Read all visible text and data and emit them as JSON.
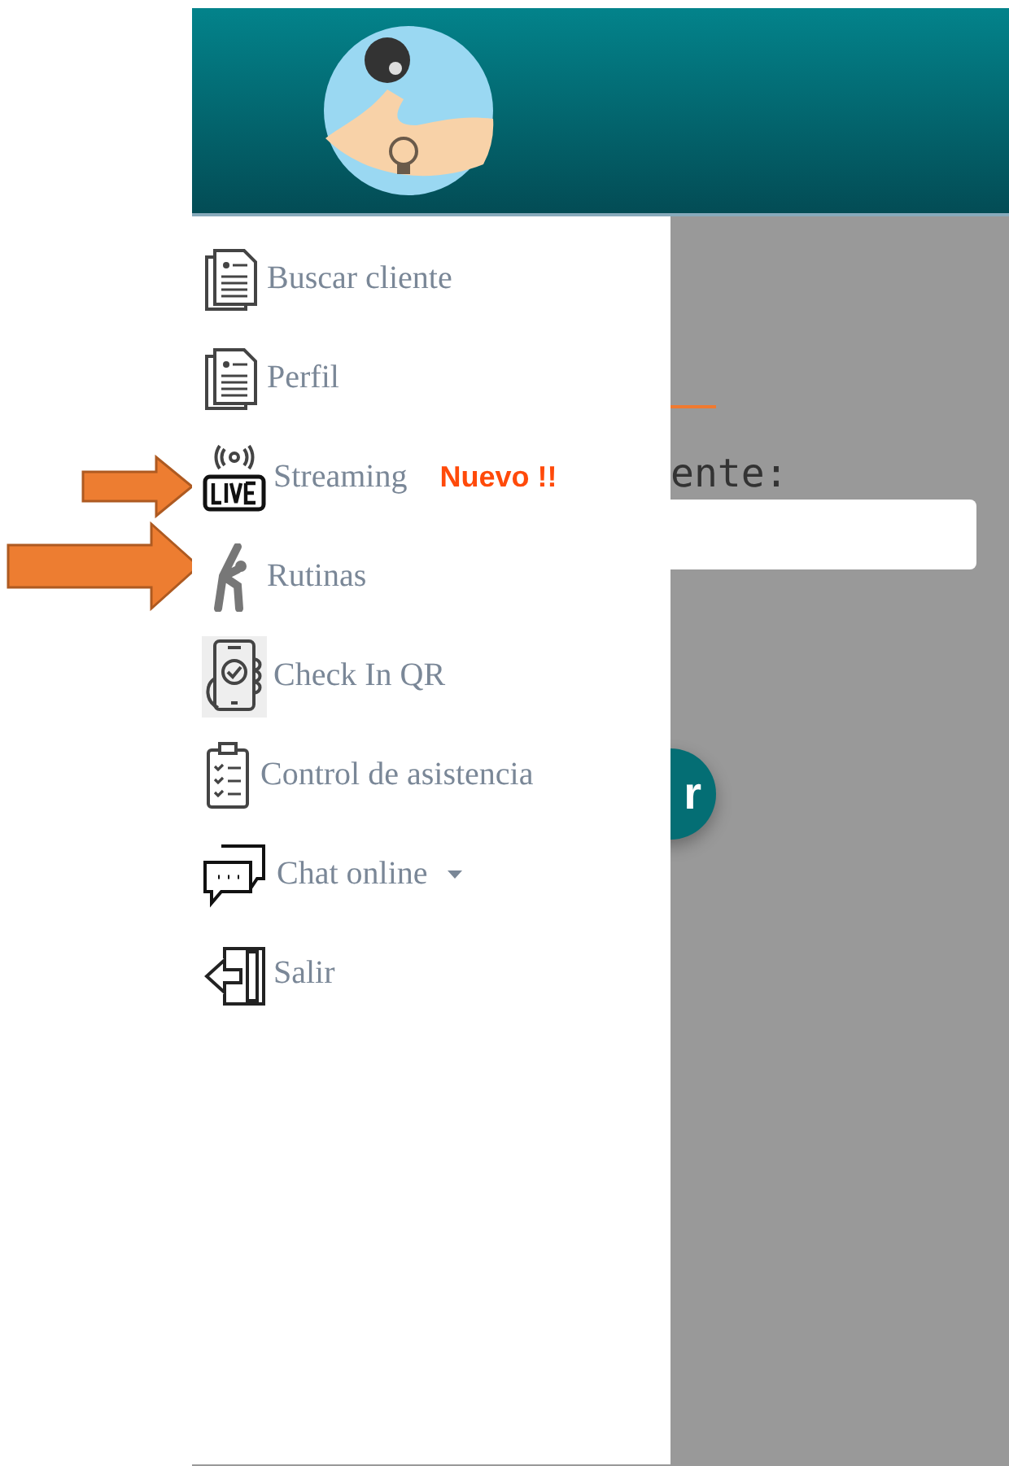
{
  "menu": [
    {
      "kind": "document",
      "label": "Buscar cliente"
    },
    {
      "kind": "document",
      "label": "Perfil"
    },
    {
      "kind": "live",
      "label": "Streaming",
      "badge": "Nuevo !!"
    },
    {
      "kind": "exercise",
      "label": "Rutinas"
    },
    {
      "kind": "phone",
      "label": "Check In QR"
    },
    {
      "kind": "clipboard",
      "label": "Control de asistencia"
    },
    {
      "kind": "chat",
      "label": "Chat online",
      "dropdown": true
    },
    {
      "kind": "exit",
      "label": "Salir"
    }
  ],
  "background": {
    "label": "ente:",
    "button_text": "r"
  }
}
